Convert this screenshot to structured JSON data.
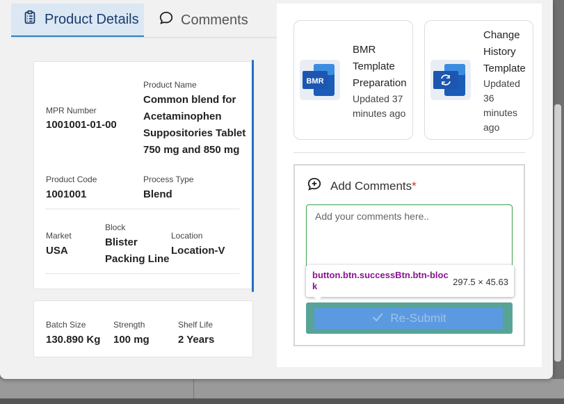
{
  "tabs": [
    {
      "label": "Product Details",
      "icon": "clipboard-icon",
      "active": true
    },
    {
      "label": "Comments",
      "icon": "chat-bubble-icon",
      "active": false
    }
  ],
  "product": {
    "mpr_number": {
      "label": "MPR Number",
      "value": "1001001-01-00"
    },
    "product_name": {
      "label": "Product Name",
      "lines": [
        "Common blend for",
        "Acetaminophen",
        "Suppositories Tablet",
        "750 mg and 850 mg"
      ]
    },
    "product_code": {
      "label": "Product Code",
      "value": "1001001"
    },
    "process_type": {
      "label": "Process Type",
      "value": "Blend"
    },
    "market": {
      "label": "Market",
      "value": "USA"
    },
    "block": {
      "label": "Block",
      "lines": [
        "Blister",
        "Packing Line"
      ]
    },
    "location": {
      "label": "Location",
      "value": "Location-V"
    }
  },
  "batch": {
    "batch_size": {
      "label": "Batch Size",
      "value": "130.890 Kg"
    },
    "strength": {
      "label": "Strength",
      "value": "100 mg"
    },
    "shelf_life": {
      "label": "Shelf Life",
      "value": "2 Years"
    }
  },
  "files": [
    {
      "icon_text": "BMR",
      "icon": "word-doc-icon",
      "title_lines": [
        "BMR",
        "Template",
        "Preparation"
      ],
      "updated_lines": [
        "Updated 37",
        "minutes ago"
      ]
    },
    {
      "icon_text": "",
      "icon": "sync-doc-icon",
      "title_lines": [
        "Change",
        "History",
        "Template"
      ],
      "updated_lines": [
        "Updated",
        "36",
        "minutes",
        "ago"
      ]
    }
  ],
  "comments": {
    "heading": "Add Comments",
    "required_mark": "*",
    "placeholder": "Add your comments here..",
    "submit_label": "Re-Submit"
  },
  "devtools_tooltip": {
    "selector": "button.btn.successBtn.btn-block",
    "dimensions": "297.5 × 45.63"
  },
  "colors": {
    "accent": "#2270c2",
    "tab_active_bg": "#dbe8f3",
    "success": "#3aa14a",
    "required": "#d32f2f"
  }
}
